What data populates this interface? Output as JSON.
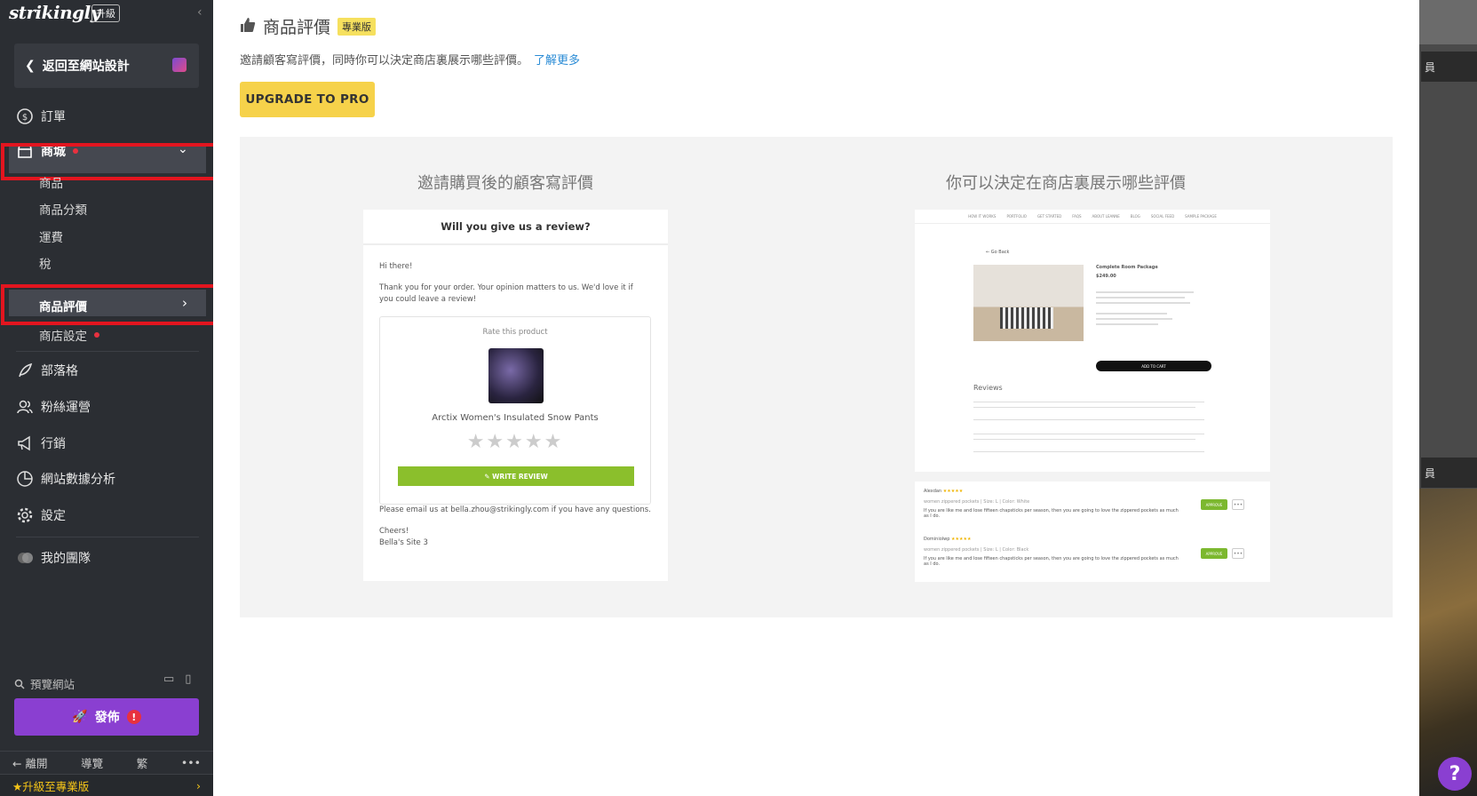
{
  "sidebar": {
    "logo": "strikingly",
    "upgrade_badge": "升級",
    "back_label": "返回至網站設計",
    "nav": {
      "orders": "訂單",
      "shop": "商城",
      "blog": "部落格",
      "fans": "粉絲運營",
      "marketing": "行銷",
      "analytics": "網站數據分析",
      "settings": "設定",
      "team": "我的團隊"
    },
    "shop_sub": {
      "products": "商品",
      "categories": "商品分類",
      "shipping": "運費",
      "tax": "稅",
      "reviews": "商品評價",
      "store_settings": "商店設定"
    },
    "preview_label": "預覽網站",
    "publish_label": "發佈",
    "publish_alert": "!",
    "bottom": {
      "leave": "離開",
      "guide": "導覽",
      "lang": "繁",
      "more": "•••"
    },
    "upgrade_pro": "★升級至專業版"
  },
  "main": {
    "title": "商品評價",
    "pro_tag": "專業版",
    "description": "邀請顧客寫評價，同時你可以決定商店裏展示哪些評價。",
    "learn_more": "了解更多",
    "upgrade_button": "UPGRADE TO PRO",
    "left_heading": "邀請購買後的顧客寫評價",
    "right_heading": "你可以決定在商店裏展示哪些評價",
    "email": {
      "header": "Will you give us a review?",
      "greeting": "Hi there!",
      "body": "Thank you for your order. Your opinion matters to us. We'd love it if you could leave a review!",
      "rate_label": "Rate this product",
      "product_name": "Arctix Women's Insulated Snow Pants",
      "stars": "★★★★★",
      "write_review": "✎ WRITE REVIEW",
      "contact": "Please email us at bella.zhou@strikingly.com if you have any questions.",
      "signoff": "Cheers!",
      "site": "Bella's Site 3"
    },
    "store": {
      "nav_items": [
        "HOW IT WORKS",
        "PORTFOLIO",
        "GET STARTED",
        "FAQS",
        "ABOUT LEANNE",
        "BLOG",
        "SOCIAL FEED",
        "SAMPLE PACKAGE"
      ],
      "go_back": "← Go Back",
      "product_title": "Complete Room Package",
      "price": "$249.00",
      "add_to_cart": "ADD TO CART",
      "reviews_heading": "Reviews"
    },
    "approve_rows": [
      {
        "name": "Alexdan",
        "stars": "★★★★★",
        "meta": "women zippered pockets | Size: L | Color: White",
        "text": "If you are like me and lose fifteen chapsticks per season, then you are going to love the zippered pockets as much as I do.",
        "action": "APPROVE",
        "more": "•••"
      },
      {
        "name": "Dominiolwp",
        "stars": "★★★★★",
        "meta": "women zippered pockets | Size: L | Color: Black",
        "text": "If you are like me and lose fifteen chapsticks per season, then you are going to love the zippered pockets as much as I do.",
        "action": "APPROVE",
        "more": "•••"
      }
    ]
  },
  "backdrop": {
    "label_top": "員",
    "label_bottom": "員"
  },
  "help_label": "?"
}
